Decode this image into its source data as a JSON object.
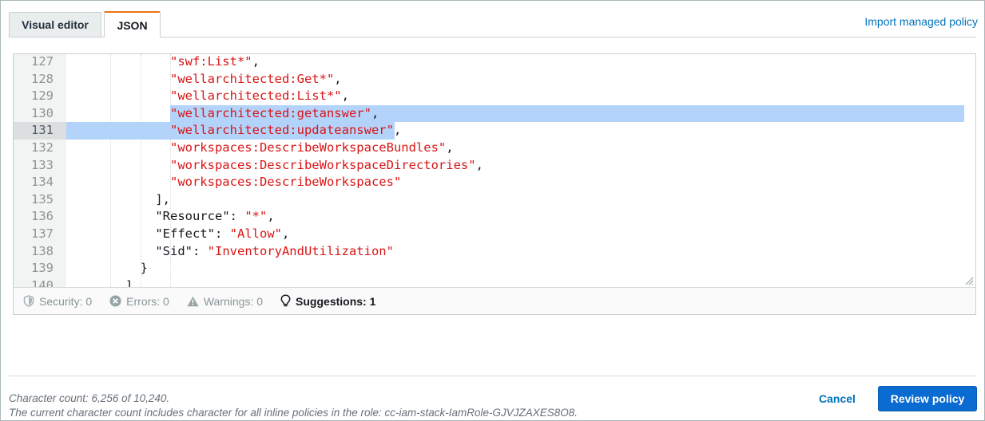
{
  "tabs": {
    "visual_editor": "Visual editor",
    "json": "JSON"
  },
  "import_link": "Import managed policy",
  "editor": {
    "lines": [
      {
        "num": "127",
        "indent": "            ",
        "parts": [
          {
            "t": "\"swf:List*\"",
            "s": true
          },
          {
            "t": ",",
            "s": false
          }
        ]
      },
      {
        "num": "128",
        "indent": "            ",
        "parts": [
          {
            "t": "\"wellarchitected:Get*\"",
            "s": true
          },
          {
            "t": ",",
            "s": false
          }
        ]
      },
      {
        "num": "129",
        "indent": "            ",
        "parts": [
          {
            "t": "\"wellarchitected:List*\"",
            "s": true
          },
          {
            "t": ",",
            "s": false
          }
        ]
      },
      {
        "num": "130",
        "indent": "            ",
        "parts": [
          {
            "t": "\"wellarchitected:getanswer\"",
            "s": true
          },
          {
            "t": ",",
            "s": false
          }
        ]
      },
      {
        "num": "131",
        "indent": "            ",
        "parts": [
          {
            "t": "\"wellarchitected:updateanswer\"",
            "s": true
          },
          {
            "t": ",",
            "s": false
          }
        ]
      },
      {
        "num": "132",
        "indent": "            ",
        "parts": [
          {
            "t": "\"workspaces:DescribeWorkspaceBundles\"",
            "s": true
          },
          {
            "t": ",",
            "s": false
          }
        ]
      },
      {
        "num": "133",
        "indent": "            ",
        "parts": [
          {
            "t": "\"workspaces:DescribeWorkspaceDirectories\"",
            "s": true
          },
          {
            "t": ",",
            "s": false
          }
        ]
      },
      {
        "num": "134",
        "indent": "            ",
        "parts": [
          {
            "t": "\"workspaces:DescribeWorkspaces\"",
            "s": true
          }
        ]
      },
      {
        "num": "135",
        "indent": "          ",
        "parts": [
          {
            "t": "],",
            "s": false
          }
        ]
      },
      {
        "num": "136",
        "indent": "          ",
        "parts": [
          {
            "t": "\"Resource\": ",
            "s": false
          },
          {
            "t": "\"*\"",
            "s": true
          },
          {
            "t": ",",
            "s": false
          }
        ]
      },
      {
        "num": "137",
        "indent": "          ",
        "parts": [
          {
            "t": "\"Effect\": ",
            "s": false
          },
          {
            "t": "\"Allow\"",
            "s": true
          },
          {
            "t": ",",
            "s": false
          }
        ]
      },
      {
        "num": "138",
        "indent": "          ",
        "parts": [
          {
            "t": "\"Sid\": ",
            "s": false
          },
          {
            "t": "\"InventoryAndUtilization\"",
            "s": true
          }
        ]
      },
      {
        "num": "139",
        "indent": "        ",
        "parts": [
          {
            "t": "}",
            "s": false
          }
        ]
      },
      {
        "num": "140",
        "indent": "      ",
        "parts": [
          {
            "t": "]",
            "s": false
          }
        ]
      }
    ],
    "active_line": "131"
  },
  "status": {
    "security_label": "Security:",
    "security_count": "0",
    "errors_label": "Errors:",
    "errors_count": "0",
    "warnings_label": "Warnings:",
    "warnings_count": "0",
    "suggestions_label": "Suggestions:",
    "suggestions_count": "1"
  },
  "footer": {
    "char_count": "Character count: 6,256 of 10,240.",
    "char_note": "The current character count includes character for all inline policies in the role: cc-iam-stack-IamRole-GJVJZAXES8O8.",
    "cancel": "Cancel",
    "review": "Review policy"
  },
  "colors": {
    "accent_tab": "#ec7211",
    "link": "#0073bb",
    "primary_button": "#0a6bd1",
    "string": "#d91515",
    "selection": "#b3d3fb"
  }
}
